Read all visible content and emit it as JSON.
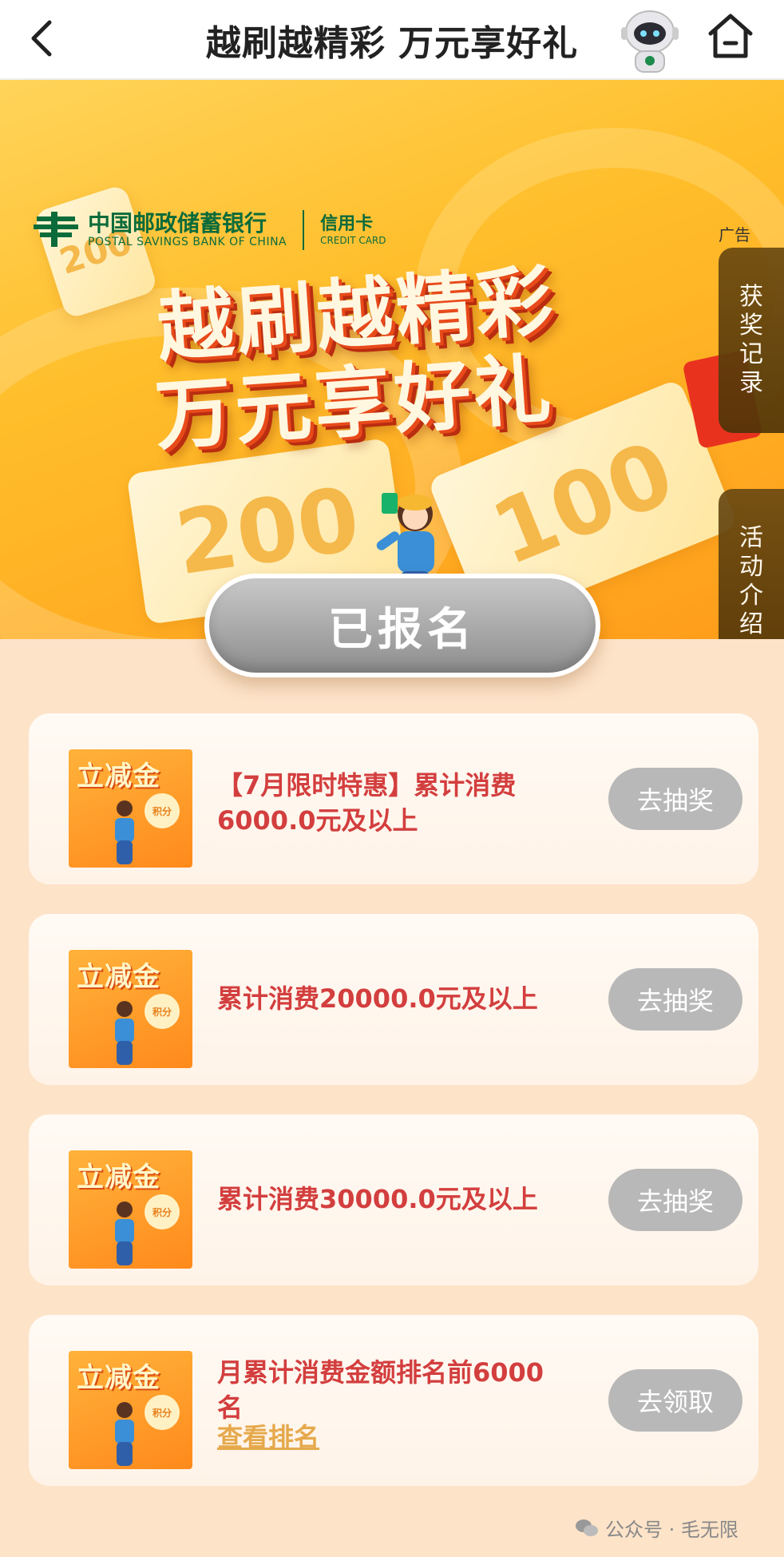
{
  "header": {
    "title": "越刷越精彩 万元享好礼"
  },
  "banner": {
    "bank_name_cn": "中国邮政储蓄银行",
    "bank_name_en": "POSTAL SAVINGS BANK OF CHINA",
    "credit_card_cn": "信用卡",
    "credit_card_en": "CREDIT CARD",
    "ad_label": "广告",
    "title_line1": "越刷越精彩",
    "title_line2": "万元享好礼",
    "ticket_small": "200",
    "ticket_left": "200",
    "ticket_right": "100",
    "side_tabs": [
      {
        "label": [
          "获",
          "奖",
          "记",
          "录"
        ]
      },
      {
        "label": [
          "活",
          "动",
          "介",
          "绍"
        ]
      }
    ]
  },
  "register_button": "已报名",
  "tasks": [
    {
      "thumb_title": "立减金",
      "thumb_badge": "积分",
      "text": "【7月限时特惠】累计消费6000.0元及以上",
      "link": "",
      "button": "去抽奖"
    },
    {
      "thumb_title": "立减金",
      "thumb_badge": "积分",
      "text": "累计消费20000.0元及以上",
      "link": "",
      "button": "去抽奖"
    },
    {
      "thumb_title": "立减金",
      "thumb_badge": "积分",
      "text": "累计消费30000.0元及以上",
      "link": "",
      "button": "去抽奖"
    },
    {
      "thumb_title": "立减金",
      "thumb_badge": "积分",
      "text": "月累计消费金额排名前6000名",
      "link": "查看排名",
      "button": "去领取"
    }
  ],
  "watermark": "公众号 · 毛无限",
  "colors": {
    "accent_red": "#d33e3e",
    "link_gold": "#e5a94c",
    "button_gray": "#b8b8b8",
    "brand_green": "#0b6b3a"
  }
}
